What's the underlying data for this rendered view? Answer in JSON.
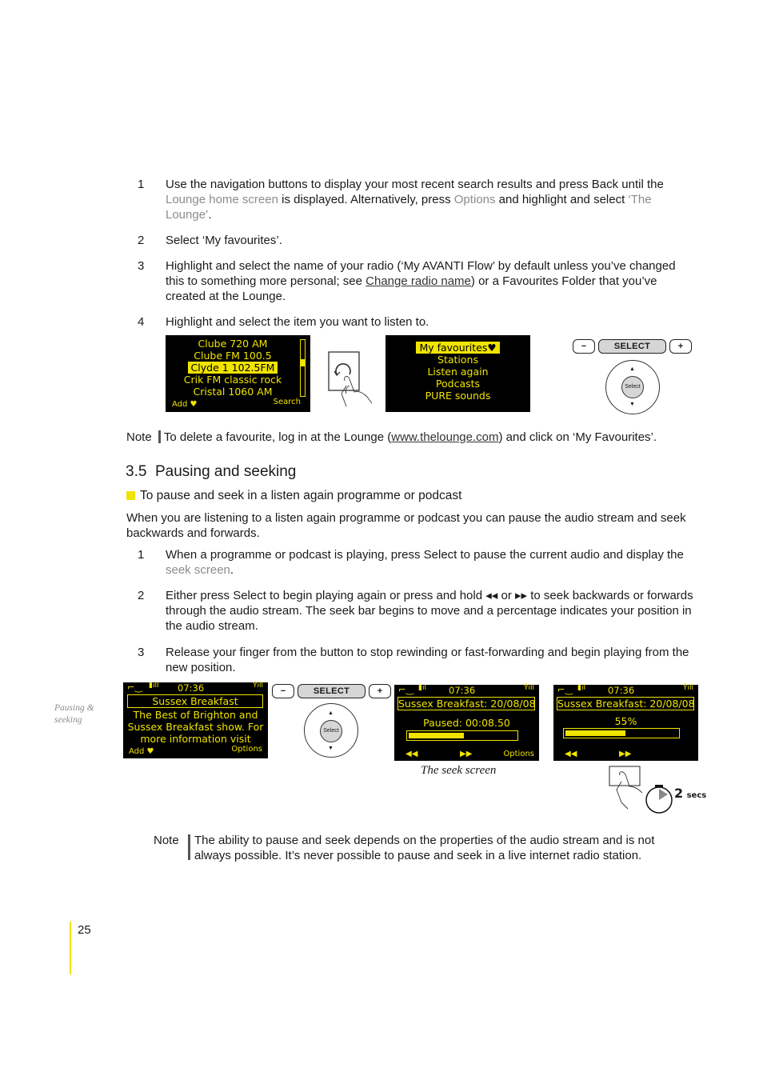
{
  "steps_a": [
    {
      "num": "1",
      "parts": [
        {
          "t": "Use the navigation buttons to display your most recent search results and press Back until the ",
          "style": "normal"
        },
        {
          "t": "Lounge home screen",
          "style": "grey"
        },
        {
          "t": " is displayed. Alternatively, press ",
          "style": "normal"
        },
        {
          "t": "Options",
          "style": "grey"
        },
        {
          "t": " and highlight and select ",
          "style": "normal"
        },
        {
          "t": "‘The Lounge’",
          "style": "grey"
        },
        {
          "t": ".",
          "style": "normal"
        }
      ]
    },
    {
      "num": "2",
      "parts": [
        {
          "t": "Select ‘My favourites’.",
          "style": "normal"
        }
      ]
    },
    {
      "num": "3",
      "parts": [
        {
          "t": "Highlight and select the name of your radio (‘My AVANTI Flow’ by default unless you’ve changed this to something more personal; see ",
          "style": "normal"
        },
        {
          "t": "Change radio name",
          "style": "link"
        },
        {
          "t": ") or a Favourites Folder that you’ve created at the Lounge.",
          "style": "normal"
        }
      ]
    },
    {
      "num": "4",
      "parts": [
        {
          "t": "Highlight and select the item you want to listen to.",
          "style": "normal"
        }
      ]
    }
  ],
  "screen_stations": {
    "items": [
      "Clube 720 AM",
      "Clube FM 100.5",
      "Clyde 1 102.5FM",
      "Crik FM classic rock",
      "Cristal 1060 AM"
    ],
    "highlighted_index": 2,
    "soft_left": "Add ♥",
    "soft_right": "Search",
    "scroll_position": 0.45
  },
  "screen_menu": {
    "items": [
      "My favourites♥",
      "Stations",
      "Listen again",
      "Podcasts",
      "PURE sounds"
    ],
    "highlighted_index": 0
  },
  "controls": {
    "minus": "−",
    "select": "SELECT",
    "plus": "+",
    "dial_center": "Select",
    "up": "▲",
    "down": "▼"
  },
  "note1": {
    "label": "Note",
    "before": "To delete a favourite, log in at the Lounge (",
    "link": "www.thelounge.com",
    "after": ") and click on ‘My Favourites’."
  },
  "section": {
    "title": "3.5  Pausing and seeking",
    "subhead": "To pause and seek in a listen again programme or podcast",
    "intro": "When you are listening to a listen again programme or podcast you can pause the audio stream and seek backwards and forwards."
  },
  "steps_b": [
    {
      "num": "1",
      "parts": [
        {
          "t": "When a programme or podcast is playing, press Select to pause the current audio and display the ",
          "style": "normal"
        },
        {
          "t": "seek screen",
          "style": "grey"
        },
        {
          "t": ".",
          "style": "normal"
        }
      ]
    },
    {
      "num": "2",
      "parts": [
        {
          "t": "Either press Select to begin playing again or press and hold ◂◂ or ▸▸ to seek backwards or forwards through the audio stream. The seek bar begins to move and a percentage indicates your position in the audio stream.",
          "style": "normal"
        }
      ]
    },
    {
      "num": "3",
      "parts": [
        {
          "t": "Release your finger from the button to stop rewinding or fast-forwarding and begin playing from the new position.",
          "style": "normal"
        }
      ]
    }
  ],
  "margin_caption": "Pausing & seeking",
  "screen_playing": {
    "time": "07:36",
    "title": "Sussex Breakfast",
    "lines": [
      "The Best of Brighton and",
      "Sussex Breakfast show. For",
      "more information visit"
    ],
    "soft_left": "Add ♥",
    "soft_right": "Options"
  },
  "screen_paused": {
    "time": "07:36",
    "title": "Sussex Breakfast: 20/08/08",
    "status": "Paused: 00:08.50",
    "progress": 0.53,
    "rew": "◀◀",
    "ffw": "▶▶",
    "soft_right": "Options"
  },
  "screen_seeking": {
    "time": "07:36",
    "title": "Sussex Breakfast: 20/08/08",
    "status": "55%",
    "progress": 0.55,
    "rew": "◀◀",
    "ffw": "▶▶"
  },
  "seek_caption": "The seek screen",
  "hold_label": {
    "num": "2",
    "unit": "secs"
  },
  "note2": {
    "label": "Note",
    "text": "The ability to pause and seek depends on the properties of the audio stream and is not always possible. It’s never possible to pause and seek in a live internet radio station."
  },
  "page_number": "25",
  "colors": {
    "lcd_yellow": "#f0e400",
    "accent_yellow": "#f0e400",
    "muted_grey": "#8c8c8c"
  }
}
